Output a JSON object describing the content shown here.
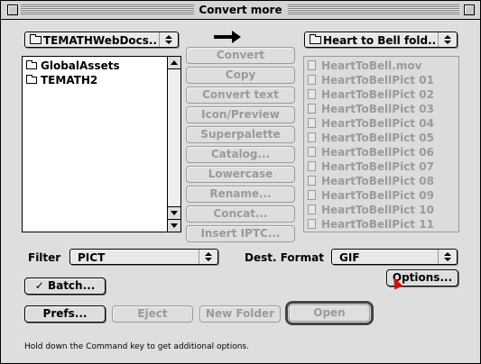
{
  "window": {
    "title": "Convert more"
  },
  "source_popup": {
    "label": "TEMATHWebDocs..."
  },
  "dest_popup": {
    "label": "Heart to Bell fold..."
  },
  "source_list": {
    "items": [
      {
        "label": "GlobalAssets"
      },
      {
        "label": "TEMATH2"
      }
    ]
  },
  "dest_list": {
    "items": [
      {
        "label": "HeartToBell.mov"
      },
      {
        "label": "HeartToBellPict 01"
      },
      {
        "label": "HeartToBellPict 02"
      },
      {
        "label": "HeartToBellPict 03"
      },
      {
        "label": "HeartToBellPict 04"
      },
      {
        "label": "HeartToBellPict 05"
      },
      {
        "label": "HeartToBellPict 06"
      },
      {
        "label": "HeartToBellPict 07"
      },
      {
        "label": "HeartToBellPict 08"
      },
      {
        "label": "HeartToBellPict 09"
      },
      {
        "label": "HeartToBellPict 10"
      },
      {
        "label": "HeartToBellPict 11"
      }
    ]
  },
  "actions": {
    "convert": "Convert",
    "copy": "Copy",
    "convert_text": "Convert text",
    "icon_preview": "Icon/Preview",
    "superpalette": "Superpalette",
    "catalog": "Catalog...",
    "lowercase": "Lowercase",
    "rename": "Rename...",
    "concat": "Concat...",
    "insert_iptc": "Insert IPTC..."
  },
  "filter": {
    "label": "Filter",
    "value": "PICT"
  },
  "dest_format": {
    "label": "Dest. Format",
    "value": "GIF"
  },
  "buttons": {
    "options": "Options...",
    "batch": "✓ Batch...",
    "prefs": "Prefs...",
    "eject": "Eject",
    "new_folder": "New Folder",
    "open": "Open"
  },
  "hint": "Hold down the Command key to get additional options."
}
